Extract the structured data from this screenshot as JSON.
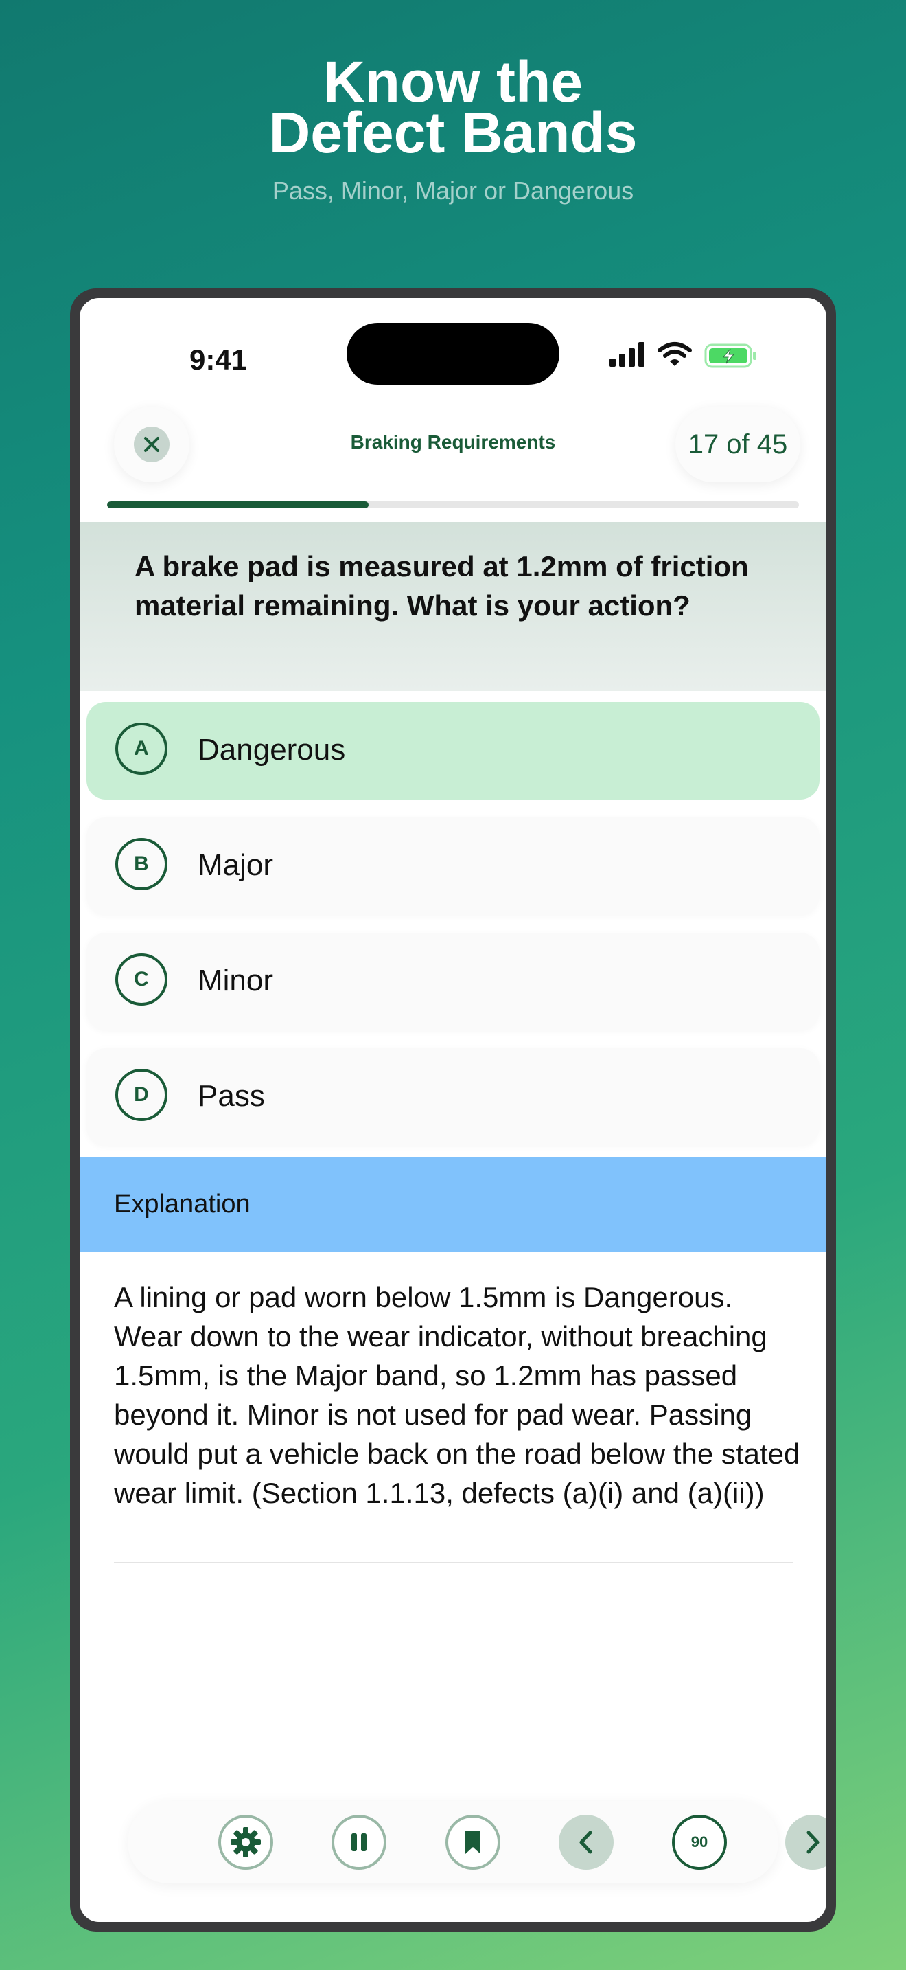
{
  "hero": {
    "title_line1": "Know the",
    "title_line2": "Defect Bands",
    "subtitle": "Pass, Minor, Major or Dangerous"
  },
  "status_bar": {
    "time": "9:41"
  },
  "header": {
    "title": "Braking Requirements",
    "counter": "17 of 45"
  },
  "progress": {
    "current": 17,
    "total": 45,
    "fraction": 0.378
  },
  "question": {
    "text": "A brake pad is measured at 1.2mm of friction material remaining. What is your action?"
  },
  "options": [
    {
      "letter": "A",
      "label": "Dangerous",
      "selected": true
    },
    {
      "letter": "B",
      "label": "Major",
      "selected": false
    },
    {
      "letter": "C",
      "label": "Minor",
      "selected": false
    },
    {
      "letter": "D",
      "label": "Pass",
      "selected": false
    }
  ],
  "explanation": {
    "title": "Explanation",
    "body": "A lining or pad worn below 1.5mm is Dangerous. Wear down to the wear indicator, without breaching 1.5mm, is the Major band, so 1.2mm has passed beyond it. Minor is not used for pad wear. Passing would put a vehicle back on the road below the stated wear limit. (Section 1.1.13, defects (a)(i) and (a)(ii))"
  },
  "toolbar": {
    "timer": "90",
    "icons": [
      "gear-icon",
      "pause-icon",
      "bookmark-icon",
      "chevron-left-icon",
      "timer-icon",
      "chevron-right-icon"
    ]
  },
  "colors": {
    "primary": "#1a5b38",
    "selected_bg": "#c8eed4",
    "explanation_bg": "#80c2fc",
    "battery": "#4cd964"
  }
}
